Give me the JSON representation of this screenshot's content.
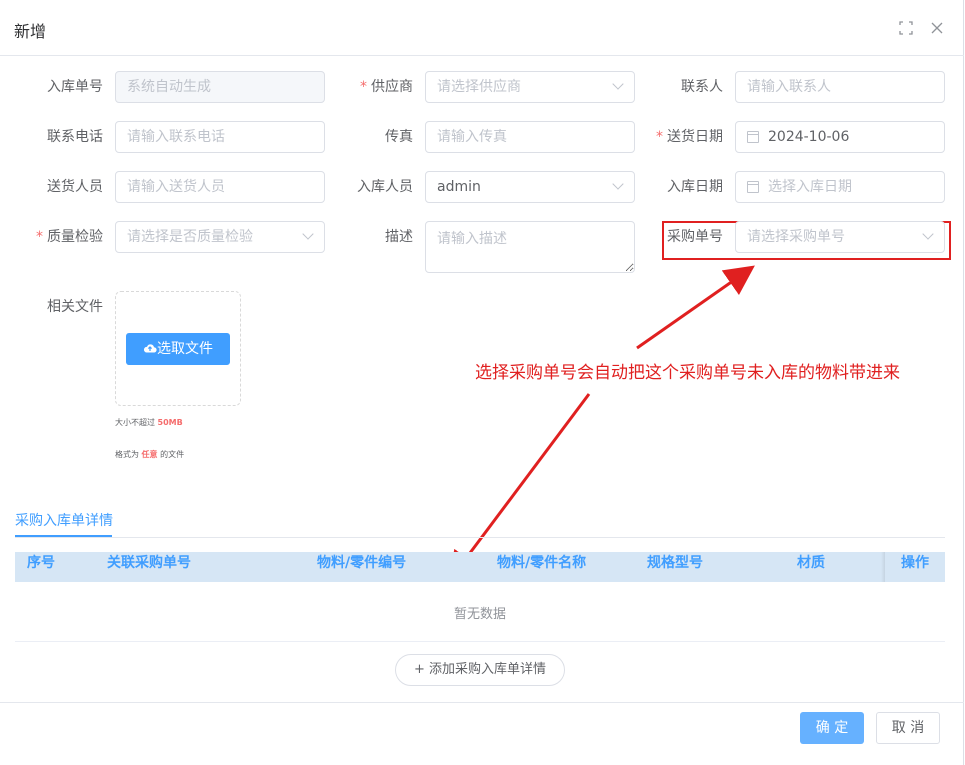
{
  "dialog": {
    "title": "新增",
    "maximize_icon": "maximize-icon",
    "close_icon": "close-icon"
  },
  "form": {
    "inbound_no": {
      "label": "入库单号",
      "value": "系统自动生成"
    },
    "supplier": {
      "label": "供应商",
      "placeholder": "请选择供应商",
      "required": true
    },
    "contact": {
      "label": "联系人",
      "placeholder": "请输入联系人"
    },
    "phone": {
      "label": "联系电话",
      "placeholder": "请输入联系电话"
    },
    "fax": {
      "label": "传真",
      "placeholder": "请输入传真"
    },
    "delivery_date": {
      "label": "送货日期",
      "value": "2024-10-06",
      "required": true
    },
    "delivery_person": {
      "label": "送货人员",
      "placeholder": "请输入送货人员"
    },
    "inbound_person": {
      "label": "入库人员",
      "value": "admin"
    },
    "inbound_date": {
      "label": "入库日期",
      "placeholder": "选择入库日期"
    },
    "quality_check": {
      "label": "质量检验",
      "placeholder": "请选择是否质量检验",
      "required": true
    },
    "description": {
      "label": "描述",
      "placeholder": "请输入描述"
    },
    "purchase_no": {
      "label": "采购单号",
      "placeholder": "请选择采购单号"
    },
    "files": {
      "label": "相关文件",
      "button": "选取文件",
      "tip1_prefix": "大小不超过",
      "tip1_value": "50MB",
      "tip2_prefix": "格式为",
      "tip2_value": "任意",
      "tip2_suffix": "的文件"
    }
  },
  "annotation": "选择采购单号会自动把这个采购单号未入库的物料带进来",
  "detail": {
    "tab": "采购入库单详情",
    "columns": [
      "序号",
      "关联采购单号",
      "物料/零件编号",
      "物料/零件名称",
      "规格型号",
      "材质",
      "操作"
    ],
    "empty_text": "暂无数据",
    "add_button": "+ 添加采购入库单详情"
  },
  "footer": {
    "ok": "确 定",
    "cancel": "取 消"
  },
  "colors": {
    "primary": "#409eff",
    "required": "#f56c6c",
    "annotation": "#e02020"
  }
}
